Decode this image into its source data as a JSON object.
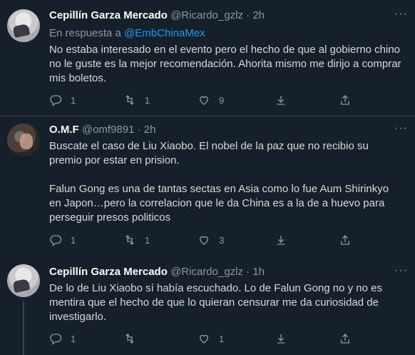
{
  "tweets": [
    {
      "name": "Cepillín Garza Mercado",
      "handle": "@Ricardo_gzlz",
      "sep": "·",
      "time": "2h",
      "reply_prefix": "En respuesta a ",
      "reply_mention": "@EmbChinaMex",
      "text": "No estaba interesado en el evento pero el hecho de que al gobierno chino no le guste es la mejor recomendación. Ahorita mismo me dirijo a comprar mis boletos.",
      "replies": "1",
      "retweets": "1",
      "likes": "9"
    },
    {
      "name": "O.M.F",
      "handle": "@omf9891",
      "sep": "·",
      "time": "2h",
      "text": "Buscate el caso de Liu Xiaobo. El nobel de la paz que no recibio su premio por estar en prision.\n\nFalun Gong es una de tantas sectas en Asia como lo fue Aum Shirinkyo en Japon…pero la correlacion que le da China es a la de a huevo para perseguir presos politicos",
      "replies": "1",
      "retweets": "1",
      "likes": "3"
    },
    {
      "name": "Cepillín Garza Mercado",
      "handle": "@Ricardo_gzlz",
      "sep": "·",
      "time": "1h",
      "text": "De lo de Liu Xiaobo sí había escuchado. Lo de Falun Gong no y no es mentira que el hecho de que lo quieran censurar me da curiosidad de investigarlo.",
      "replies": "1",
      "retweets": "",
      "likes": "1"
    }
  ],
  "more_label": "···",
  "icons": [
    "reply-icon",
    "retweet-icon",
    "like-icon",
    "bookmark-icon",
    "share-icon",
    "more-icon"
  ],
  "colors": {
    "background": "#15202b",
    "text": "#d9d9d9",
    "muted": "#8b98a5",
    "accent": "#1d9bf0",
    "divider": "#38444d"
  }
}
